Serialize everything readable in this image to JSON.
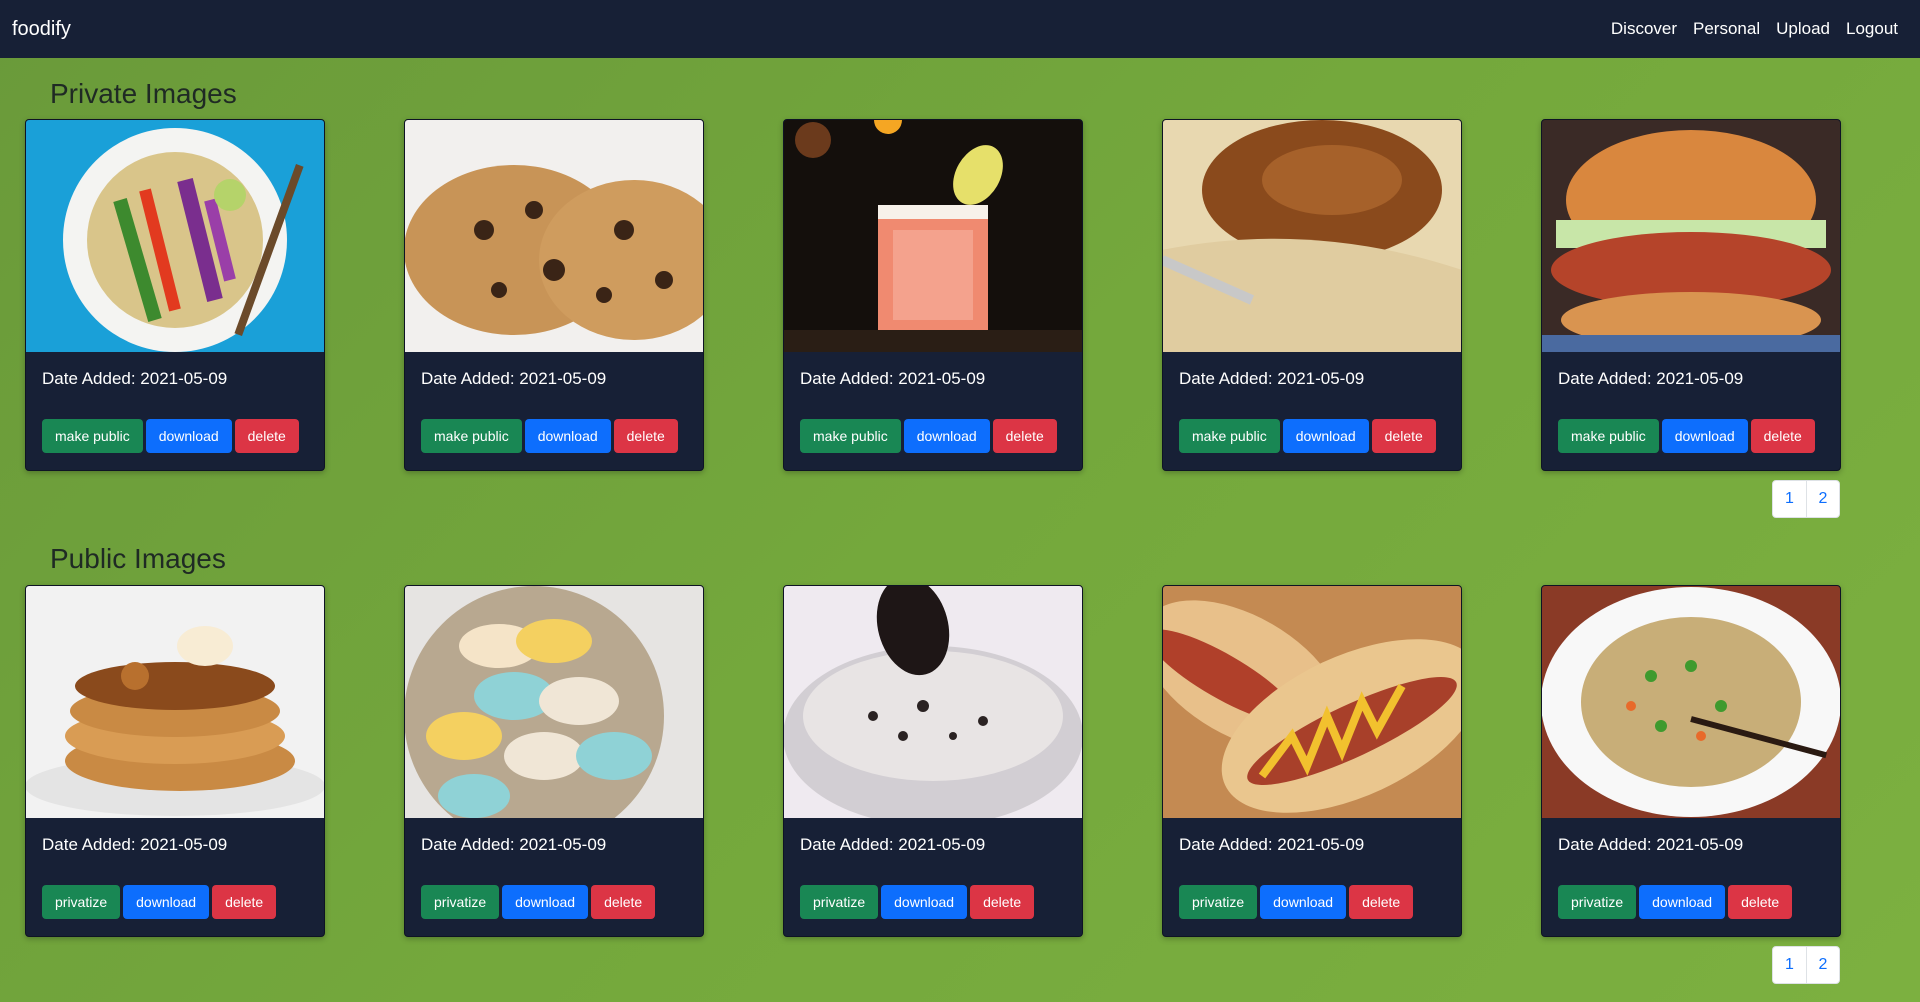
{
  "navbar": {
    "brand": "foodify",
    "links": [
      "Discover",
      "Personal",
      "Upload",
      "Logout"
    ]
  },
  "private_section": {
    "title": "Private Images",
    "cards": [
      {
        "date": "Date Added: 2021-05-09",
        "image": "salad-bowl-image",
        "actions": [
          "make public",
          "download",
          "delete"
        ]
      },
      {
        "date": "Date Added: 2021-05-09",
        "image": "chocolate-chip-cookies-image",
        "actions": [
          "make public",
          "download",
          "delete"
        ]
      },
      {
        "date": "Date Added: 2021-05-09",
        "image": "pink-cocktail-image",
        "actions": [
          "make public",
          "download",
          "delete"
        ]
      },
      {
        "date": "Date Added: 2021-05-09",
        "image": "chicken-and-rice-image",
        "actions": [
          "make public",
          "download",
          "delete"
        ]
      },
      {
        "date": "Date Added: 2021-05-09",
        "image": "chicken-sandwich-image",
        "actions": [
          "make public",
          "download",
          "delete"
        ]
      }
    ],
    "pages": [
      "1",
      "2"
    ]
  },
  "public_section": {
    "title": "Public Images",
    "cards": [
      {
        "date": "Date Added: 2021-05-09",
        "image": "pancakes-image",
        "actions": [
          "privatize",
          "download",
          "delete"
        ]
      },
      {
        "date": "Date Added: 2021-05-09",
        "image": "macarons-image",
        "actions": [
          "privatize",
          "download",
          "delete"
        ]
      },
      {
        "date": "Date Added: 2021-05-09",
        "image": "oreo-dessert-image",
        "actions": [
          "privatize",
          "download",
          "delete"
        ]
      },
      {
        "date": "Date Added: 2021-05-09",
        "image": "hot-dogs-image",
        "actions": [
          "privatize",
          "download",
          "delete"
        ]
      },
      {
        "date": "Date Added: 2021-05-09",
        "image": "fried-rice-image",
        "actions": [
          "privatize",
          "download",
          "delete"
        ]
      }
    ],
    "pages": [
      "1",
      "2"
    ]
  },
  "colors": {
    "navbar": "#172036",
    "card": "#172036",
    "make_public_button": "#198754",
    "download_button": "#0d6efd",
    "delete_button": "#dc3545",
    "background": "#74a83c"
  }
}
